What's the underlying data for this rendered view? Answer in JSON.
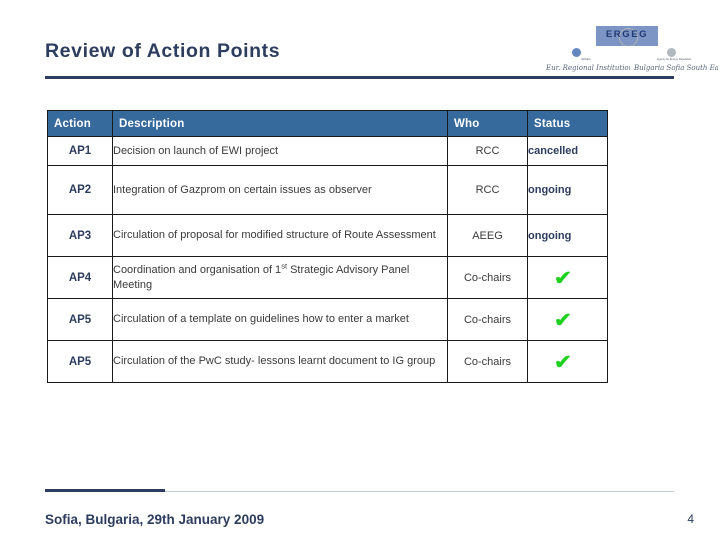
{
  "slide": {
    "title": "Review of Action Points",
    "accent_color": "#2c3d5e",
    "header_color": "#36699c",
    "check_color": "#1fd11f"
  },
  "logos": {
    "ergeg": {
      "wordmark": "ERGEG",
      "icon": "eu-stars-icon"
    },
    "left": {
      "icon": "organisation-emblem-icon",
      "microtext": "ERGEG",
      "script": "Eur. Regional Institution"
    },
    "right": {
      "icon": "organisation-seal-icon",
      "microtext": "Agency for Energy Regulation",
      "script": "Bulgaria Sofia South East"
    }
  },
  "table": {
    "columns": [
      "Action",
      "Description",
      "Who",
      "Status"
    ],
    "rows": [
      {
        "action": "AP1",
        "description": "Decision on launch of EWI project",
        "who": "RCC",
        "status": "cancelled",
        "status_type": "text",
        "height_class": "row-h1"
      },
      {
        "action": "AP2",
        "description": "Integration of Gazprom on certain issues as observer",
        "who": "RCC",
        "status": "ongoing",
        "status_type": "text",
        "height_class": "row-h2"
      },
      {
        "action": "AP3",
        "description": "Circulation of proposal for modified structure of Route Assessment",
        "who": "AEEG",
        "status": "ongoing",
        "status_type": "text",
        "height_class": "row-h3"
      },
      {
        "action": "AP4",
        "description_pre": "Coordination and organisation of 1",
        "description_sup": "st",
        "description_post": " Strategic Advisory Panel Meeting",
        "description": "Coordination and organisation of 1st Strategic Advisory Panel Meeting",
        "who": "Co-chairs",
        "status": "✔",
        "status_type": "check",
        "height_class": "row-h3"
      },
      {
        "action": "AP5",
        "description": "Circulation of a template on guidelines how to enter a market",
        "who": "Co-chairs",
        "status": "✔",
        "status_type": "check",
        "height_class": "row-h3"
      },
      {
        "action": "AP5",
        "description": "Circulation of the PwC study- lessons learnt document to IG group",
        "who": "Co-chairs",
        "status": "✔",
        "status_type": "check",
        "height_class": "row-h3"
      }
    ]
  },
  "footer": {
    "text": "Sofia, Bulgaria, 29th January 2009",
    "page_number": "4"
  }
}
